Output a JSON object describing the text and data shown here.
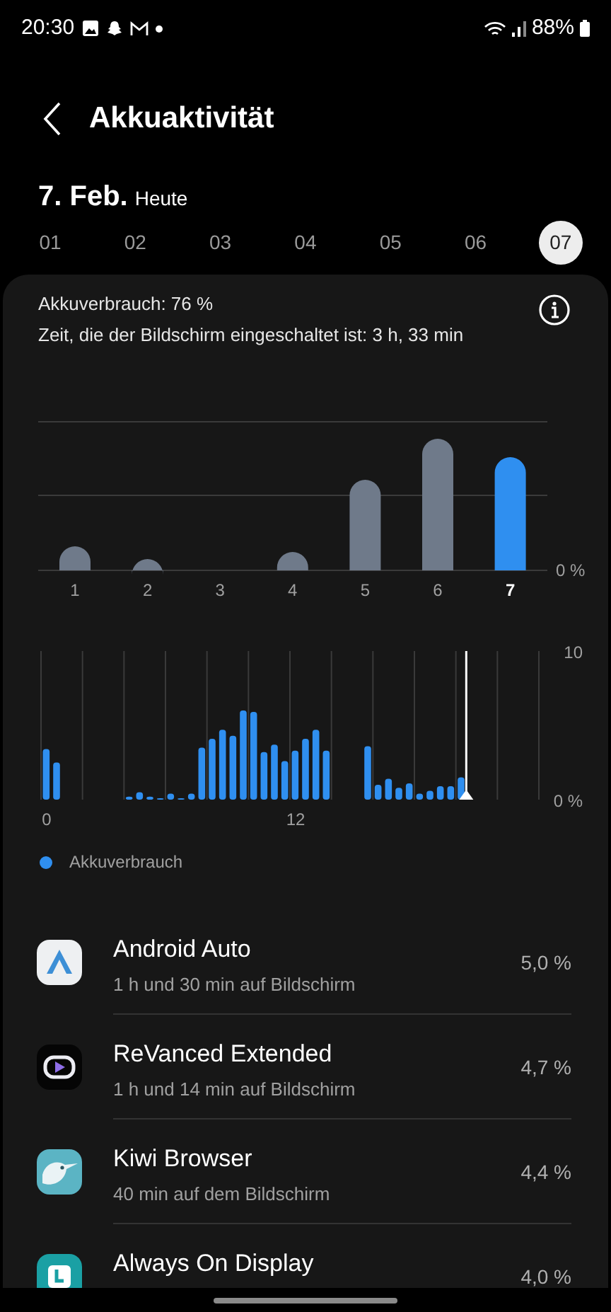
{
  "status_bar": {
    "time": "20:30",
    "battery": "88%"
  },
  "header": {
    "title": "Akkuaktivität"
  },
  "date": {
    "day": "7. Feb.",
    "label": "Heute"
  },
  "date_tabs": [
    {
      "label": "01",
      "selected": false
    },
    {
      "label": "02",
      "selected": false
    },
    {
      "label": "03",
      "selected": false
    },
    {
      "label": "04",
      "selected": false
    },
    {
      "label": "05",
      "selected": false
    },
    {
      "label": "06",
      "selected": false
    },
    {
      "label": "07",
      "selected": true
    }
  ],
  "summary": {
    "usage": "Akkuverbrauch: 76 %",
    "screen_time": "Zeit, die der Bildschirm eingeschaltet ist: 3 h, 33 min"
  },
  "weekly_chart": {
    "axis_label": "0 %",
    "day_labels": [
      {
        "label": "1",
        "selected": false
      },
      {
        "label": "2",
        "selected": false
      },
      {
        "label": "3",
        "selected": false
      },
      {
        "label": "4",
        "selected": false
      },
      {
        "label": "5",
        "selected": false
      },
      {
        "label": "6",
        "selected": false
      },
      {
        "label": "7",
        "selected": true
      }
    ]
  },
  "hourly_chart": {
    "chart_data": {
      "type": "bar",
      "x": [
        0.25,
        0.75,
        4.25,
        4.75,
        5.25,
        5.75,
        6.25,
        6.75,
        7.25,
        7.75,
        8.25,
        8.75,
        9.25,
        9.75,
        10.25,
        10.75,
        11.25,
        11.75,
        12.25,
        12.75,
        13.25,
        13.75,
        15.75,
        16.25,
        16.75,
        17.25,
        17.75,
        18.25,
        18.75,
        19.25,
        19.75,
        20.25
      ],
      "series": [
        {
          "name": "Akkuverbrauch",
          "color": "#2f8ff0",
          "values": [
            3.4,
            2.5,
            0.2,
            0.5,
            0.2,
            0.1,
            0.4,
            0.1,
            0.4,
            3.5,
            4.1,
            4.7,
            4.3,
            6.0,
            5.9,
            3.2,
            3.7,
            2.6,
            3.3,
            4.1,
            4.7,
            3.3,
            3.6,
            1.0,
            1.4,
            0.8,
            1.1,
            0.4,
            0.6,
            0.9,
            0.9,
            1.5
          ]
        }
      ],
      "xlim": [
        0,
        24
      ],
      "ylim": [
        0,
        10
      ],
      "xticks": [
        {
          "value": 0,
          "label": "0"
        },
        {
          "value": 12,
          "label": "12"
        }
      ],
      "yticks": [
        {
          "value": 0,
          "label": "0 %"
        },
        {
          "value": 10,
          "label": "10"
        }
      ],
      "ref_lines": [
        {
          "axis": "x",
          "value": 20.5
        }
      ]
    }
  },
  "apps": [
    {
      "kind": "triangle",
      "name": "Android Auto",
      "detail": "1 h und 30 min auf Bildschirm",
      "percent": "5,0 %"
    },
    {
      "kind": "play",
      "name": "ReVanced Extended",
      "detail": "1 h und 14 min auf Bildschirm",
      "percent": "4,7 %"
    },
    {
      "kind": "bird",
      "name": "Kiwi Browser",
      "detail": "40 min auf dem Bildschirm",
      "percent": "4,4 %"
    },
    {
      "kind": "clock",
      "name": "Always On Display",
      "percent": "4,0 %"
    }
  ]
}
